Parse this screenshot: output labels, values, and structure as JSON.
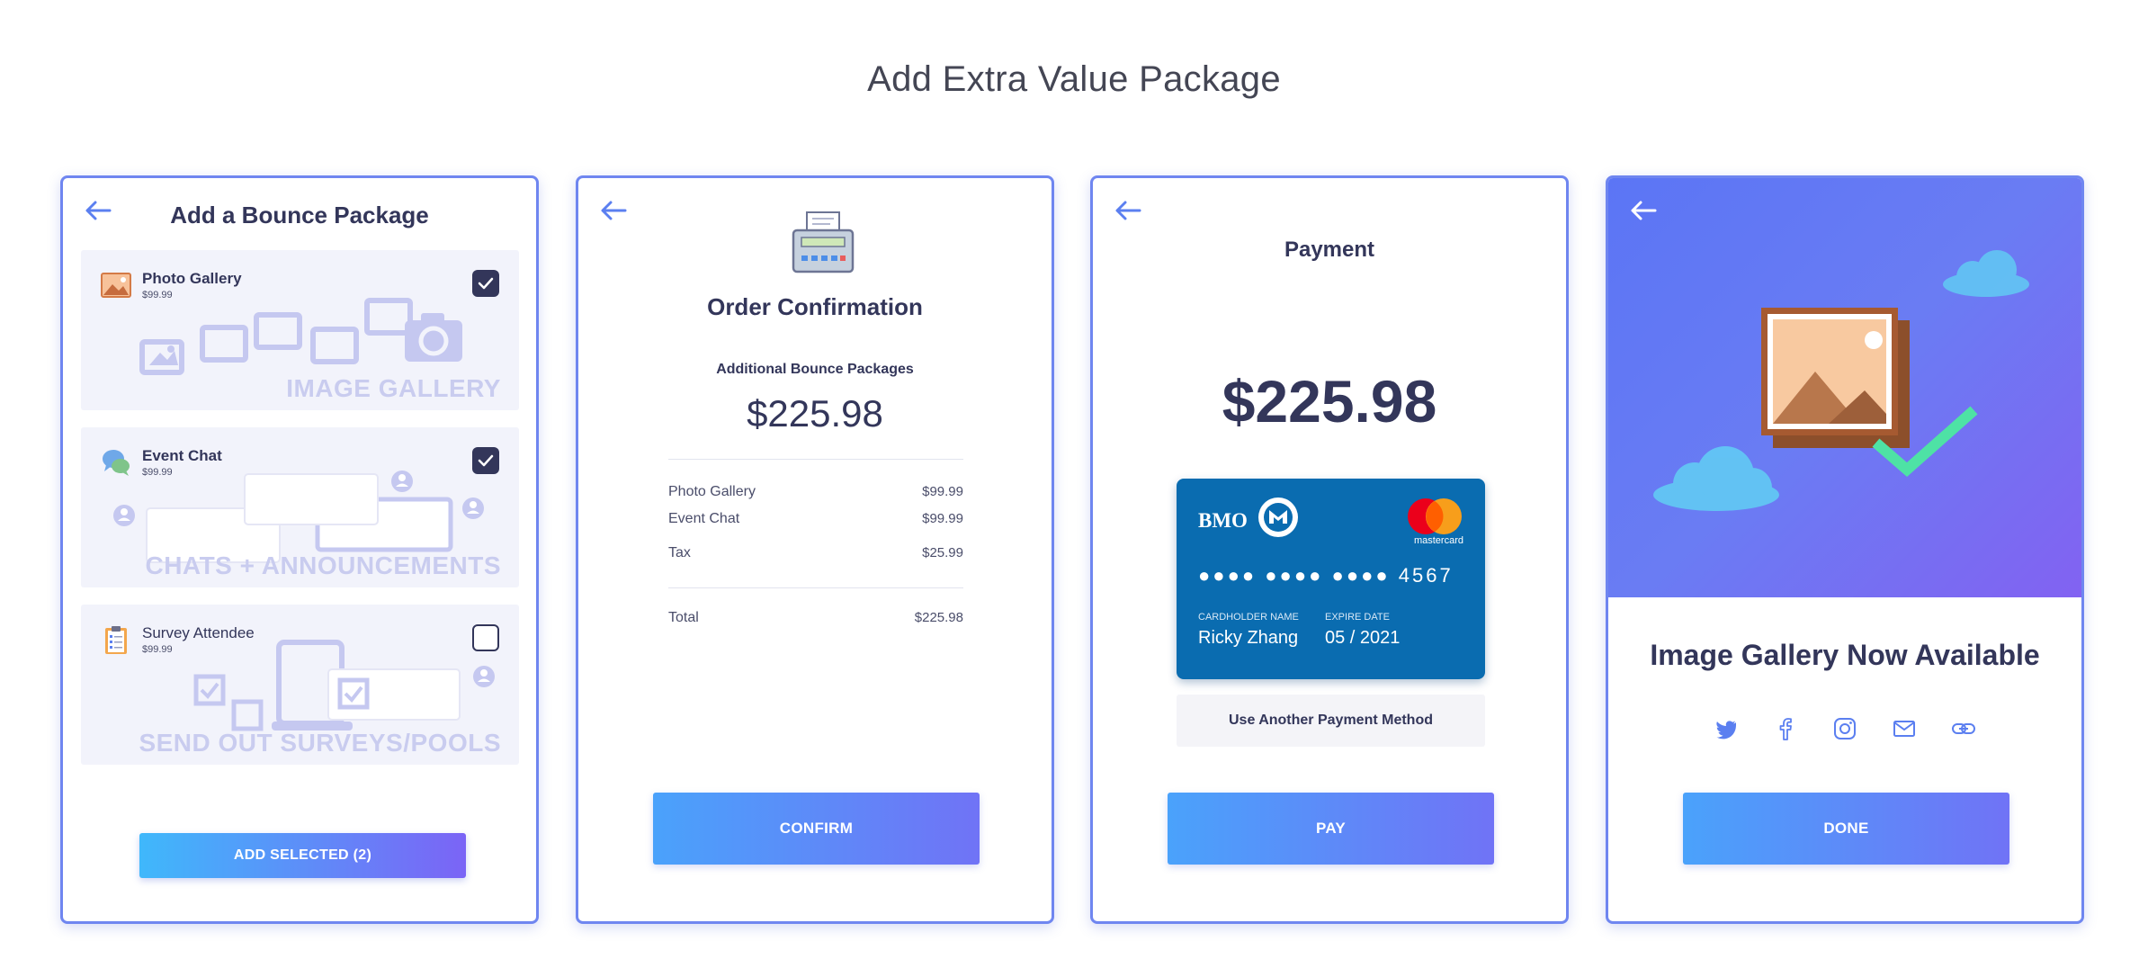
{
  "page": {
    "title": "Add Extra Value Package"
  },
  "colors": {
    "accent": "#6f86f0",
    "navy": "#33365a",
    "card_blue": "#0a6cb0"
  },
  "panel1": {
    "title": "Add a Bounce Package",
    "packages": [
      {
        "name": "Photo Gallery",
        "price": "$99.99",
        "watermark": "IMAGE GALLERY",
        "checked": true,
        "icon": "image-icon"
      },
      {
        "name": "Event Chat",
        "price": "$99.99",
        "watermark": "CHATS + ANNOUNCEMENTS",
        "checked": true,
        "icon": "chat-icon"
      },
      {
        "name": "Survey Attendee",
        "price": "$99.99",
        "watermark": "SEND OUT SURVEYS/POOLS",
        "checked": false,
        "icon": "clipboard-icon"
      }
    ],
    "button": "ADD SELECTED (2)"
  },
  "panel2": {
    "title": "Order Confirmation",
    "subtitle": "Additional Bounce Packages",
    "amount": "$225.98",
    "items": [
      {
        "label": "Photo Gallery",
        "value": "$99.99"
      },
      {
        "label": "Event Chat",
        "value": "$99.99"
      },
      {
        "label": "Tax",
        "value": "$25.99"
      }
    ],
    "total_label": "Total",
    "total_value": "$225.98",
    "button": "CONFIRM"
  },
  "panel3": {
    "title": "Payment",
    "amount": "$225.98",
    "card": {
      "bank": "BMO",
      "brand": "mastercard",
      "number": "●●●● ●●●● ●●●● 4567",
      "holder_label": "CARDHOLDER NAME",
      "holder": "Ricky Zhang",
      "expire_label": "EXPIRE DATE",
      "expire": "05 / 2021"
    },
    "alt_button": "Use Another Payment Method",
    "button": "PAY"
  },
  "panel4": {
    "title": "Image Gallery Now Available",
    "social": [
      "twitter-icon",
      "facebook-icon",
      "instagram-icon",
      "mail-icon",
      "link-icon"
    ],
    "button": "DONE"
  }
}
